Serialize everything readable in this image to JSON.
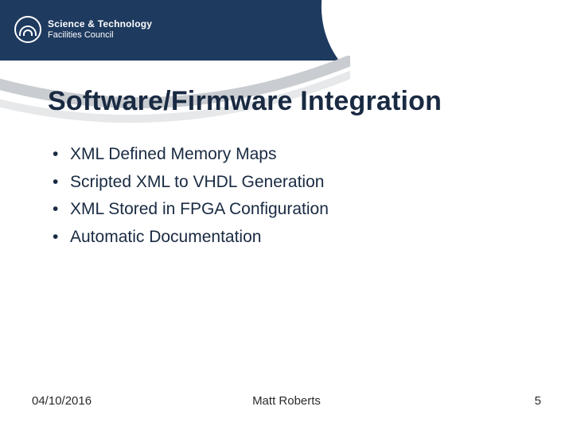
{
  "logo": {
    "line1": "Science & Technology",
    "line2": "Facilities Council"
  },
  "title": "Software/Firmware Integration",
  "bullets": [
    "XML Defined Memory Maps",
    "Scripted XML to VHDL Generation",
    "XML Stored in FPGA Configuration",
    "Automatic Documentation"
  ],
  "footer": {
    "date": "04/10/2016",
    "author": "Matt Roberts",
    "page": "5"
  }
}
